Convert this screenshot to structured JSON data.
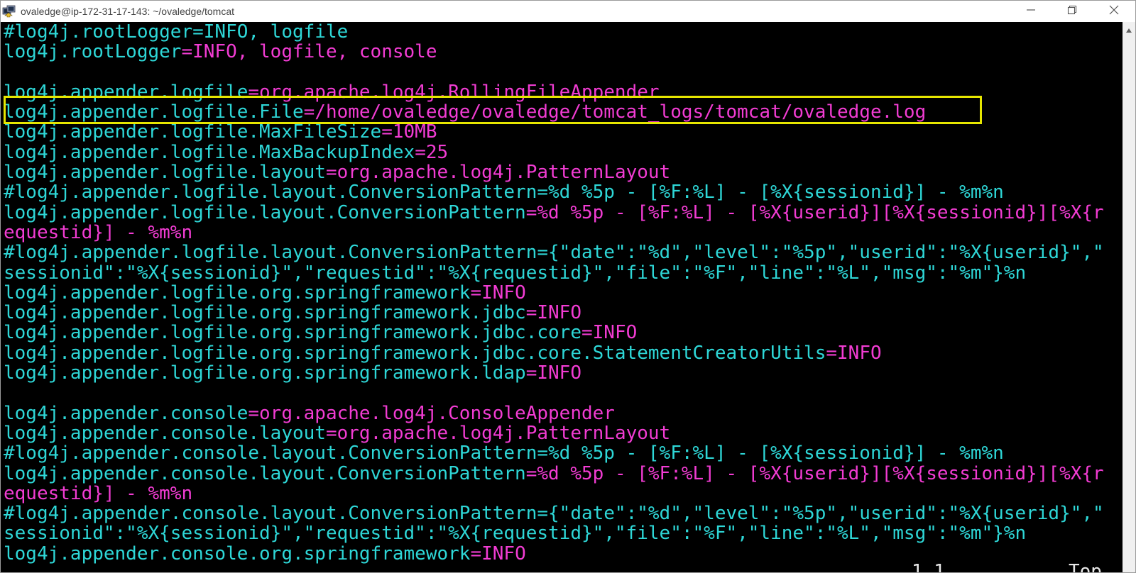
{
  "window": {
    "title": "ovaledge@ip-172-31-17-143: ~/ovaledge/tomcat",
    "icons": [
      "app-icon",
      "minimize-icon",
      "maximize-icon",
      "close-icon",
      "scroll-up-arrow-icon"
    ]
  },
  "colors": {
    "key": "#2ed7d7",
    "value": "#f23cd3",
    "highlight": "#e6e600",
    "background": "#000000"
  },
  "lines": [
    [
      {
        "t": "#log4j.rootLogger=INFO, logfile",
        "c": "k"
      }
    ],
    [
      {
        "t": "log4j.rootLogger",
        "c": "k"
      },
      {
        "t": "=INFO, logfile, console",
        "c": "v"
      }
    ],
    [],
    [
      {
        "t": "log4j.appender.logfile",
        "c": "k"
      },
      {
        "t": "=org.apache.log4j.RollingFileAppender",
        "c": "v"
      }
    ],
    [
      {
        "t": "log4j.appender.logfile.File",
        "c": "k"
      },
      {
        "t": "=/home/ovaledge/ovaledge/tomcat_logs/tomcat/ovaledge.log",
        "c": "v"
      }
    ],
    [
      {
        "t": "log4j.appender.logfile.MaxFileSize",
        "c": "k"
      },
      {
        "t": "=10MB",
        "c": "v"
      }
    ],
    [
      {
        "t": "log4j.appender.logfile.MaxBackupIndex",
        "c": "k"
      },
      {
        "t": "=25",
        "c": "v"
      }
    ],
    [
      {
        "t": "log4j.appender.logfile.layout",
        "c": "k"
      },
      {
        "t": "=org.apache.log4j.PatternLayout",
        "c": "v"
      }
    ],
    [
      {
        "t": "#log4j.appender.logfile.layout.ConversionPattern=%d %5p - [%F:%L] - [%X{sessionid}] - %m%n",
        "c": "k"
      }
    ],
    [
      {
        "t": "log4j.appender.logfile.layout.ConversionPattern",
        "c": "k"
      },
      {
        "t": "=%d %5p - [%F:%L] - [%X{userid}][%X{sessionid}][%X{r",
        "c": "v"
      }
    ],
    [
      {
        "t": "equestid}] - %m%n",
        "c": "v"
      }
    ],
    [
      {
        "t": "#log4j.appender.logfile.layout.ConversionPattern={\"date\":\"%d\",\"level\":\"%5p\",\"userid\":\"%X{userid}\",\"",
        "c": "k"
      }
    ],
    [
      {
        "t": "sessionid\":\"%X{sessionid}\",\"requestid\":\"%X{requestid}\",\"file\":\"%F\",\"line\":\"%L\",\"msg\":\"%m\"}%n",
        "c": "k"
      }
    ],
    [
      {
        "t": "log4j.appender.logfile.org.springframework",
        "c": "k"
      },
      {
        "t": "=INFO",
        "c": "v"
      }
    ],
    [
      {
        "t": "log4j.appender.logfile.org.springframework.jdbc",
        "c": "k"
      },
      {
        "t": "=INFO",
        "c": "v"
      }
    ],
    [
      {
        "t": "log4j.appender.logfile.org.springframework.jdbc.core",
        "c": "k"
      },
      {
        "t": "=INFO",
        "c": "v"
      }
    ],
    [
      {
        "t": "log4j.appender.logfile.org.springframework.jdbc.core.StatementCreatorUtils",
        "c": "k"
      },
      {
        "t": "=INFO",
        "c": "v"
      }
    ],
    [
      {
        "t": "log4j.appender.logfile.org.springframework.ldap",
        "c": "k"
      },
      {
        "t": "=INFO",
        "c": "v"
      }
    ],
    [],
    [
      {
        "t": "log4j.appender.console",
        "c": "k"
      },
      {
        "t": "=org.apache.log4j.ConsoleAppender",
        "c": "v"
      }
    ],
    [
      {
        "t": "log4j.appender.console.layout",
        "c": "k"
      },
      {
        "t": "=org.apache.log4j.PatternLayout",
        "c": "v"
      }
    ],
    [
      {
        "t": "#log4j.appender.console.layout.ConversionPattern=%d %5p - [%F:%L] - [%X{sessionid}] - %m%n",
        "c": "k"
      }
    ],
    [
      {
        "t": "log4j.appender.console.layout.ConversionPattern",
        "c": "k"
      },
      {
        "t": "=%d %5p - [%F:%L] - [%X{userid}][%X{sessionid}][%X{r",
        "c": "v"
      }
    ],
    [
      {
        "t": "equestid}] - %m%n",
        "c": "v"
      }
    ],
    [
      {
        "t": "#log4j.appender.console.layout.ConversionPattern={\"date\":\"%d\",\"level\":\"%5p\",\"userid\":\"%X{userid}\",\"",
        "c": "k"
      }
    ],
    [
      {
        "t": "sessionid\":\"%X{sessionid}\",\"requestid\":\"%X{requestid}\",\"file\":\"%F\",\"line\":\"%L\",\"msg\":\"%m\"}%n",
        "c": "k"
      }
    ],
    [
      {
        "t": "log4j.appender.console.org.springframework",
        "c": "k"
      },
      {
        "t": "=INFO",
        "c": "v"
      }
    ]
  ],
  "highlighted_line_index": 4,
  "status": {
    "position": "1,1",
    "scroll": "Top"
  }
}
